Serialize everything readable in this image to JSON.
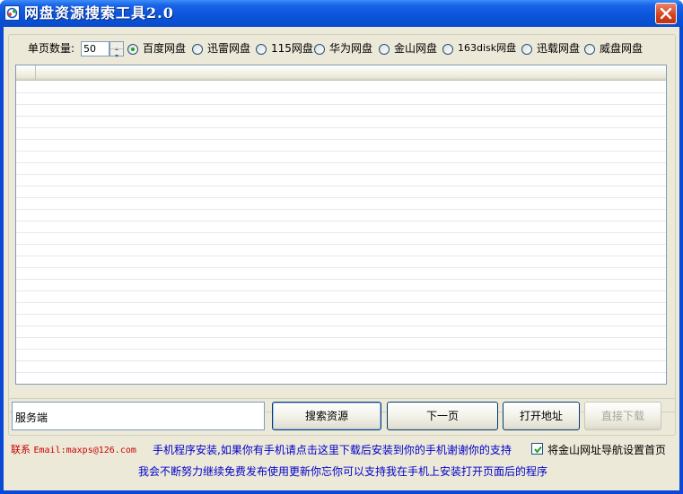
{
  "window": {
    "title": "网盘资源搜索工具2.0"
  },
  "options": {
    "page_count_label": "单页数量:",
    "page_count_value": "50",
    "sources": [
      {
        "label": "百度网盘",
        "checked": true
      },
      {
        "label": "迅雷网盘",
        "checked": false
      },
      {
        "label": "115网盘",
        "checked": false
      },
      {
        "label": "华为网盘",
        "checked": false
      },
      {
        "label": "金山网盘",
        "checked": false
      },
      {
        "label": "163disk网盘",
        "checked": false
      },
      {
        "label": "迅载网盘",
        "checked": false
      },
      {
        "label": "威盘网盘",
        "checked": false
      }
    ]
  },
  "controls": {
    "input_value": "服务端",
    "search_button": "搜索资源",
    "next_button": "下一页",
    "open_button": "打开地址",
    "download_button": "直接下载"
  },
  "footer": {
    "contact_label": "联系",
    "contact_email": "Email:maxps@126.com",
    "mobile_info": "手机程序安装,如果你有手机请点击这里下载后安装到你的手机谢谢你的支持",
    "homepage_checkbox": "将金山网址导航设置首页",
    "homepage_checked": true,
    "support_info": "我会不断努力继续免费发布使用更新你忘你可以支持我在手机上安装打开页面后的程序"
  }
}
